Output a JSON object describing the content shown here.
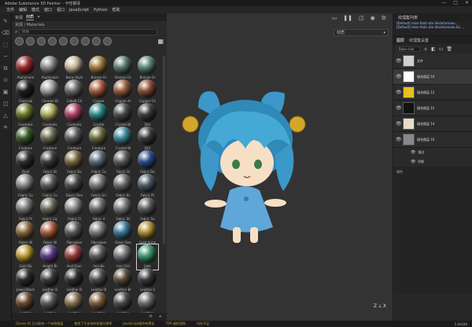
{
  "app": {
    "title": "Adobe Substance 3D Painter - 卡哇钢琴",
    "window_controls": [
      "—",
      "□",
      "✕"
    ]
  },
  "menu": [
    "文件",
    "编辑",
    "模式",
    "窗口",
    "视口",
    "JavaScript",
    "Python",
    "帮助"
  ],
  "tools": [
    "brush-icon",
    "eraser-icon",
    "projection-icon",
    "smudge-icon",
    "clone-icon",
    "picker-icon",
    "fill-icon",
    "camera-icon",
    "polygon-icon",
    "light-icon"
  ],
  "shelf": {
    "tabs": [
      "资源",
      "材质"
    ],
    "path": "资源 / Materials",
    "search_placeholder": "搜索",
    "filters": [
      "all",
      "materials",
      "smart-materials",
      "textures",
      "brushes",
      "alphas",
      "grunges",
      "procedurals",
      "environments"
    ],
    "materials": [
      {
        "label": "Aluminium",
        "color": "#9b2a2a"
      },
      {
        "label": "Aluminium",
        "color": "#8a8a8a"
      },
      {
        "label": "Bone Stylz",
        "color": "#c8b89a"
      },
      {
        "label": "Bronze Ar",
        "color": "#a07a3a"
      },
      {
        "label": "Bronze Ch",
        "color": "#5a7a6e"
      },
      {
        "label": "Bronze Gr",
        "color": "#5e8478"
      },
      {
        "label": "Charcoal",
        "color": "#1e1e1e"
      },
      {
        "label": "Chrome Bl",
        "color": "#a0a0a0"
      },
      {
        "label": "Cobalt Ch",
        "color": "#6a6a6a"
      },
      {
        "label": "Copper",
        "color": "#a95a3a"
      },
      {
        "label": "Copper Ar",
        "color": "#9a5a3a"
      },
      {
        "label": "Copper Ch",
        "color": "#8a4a32"
      },
      {
        "label": "Cosmetic",
        "color": "#6a7a2a"
      },
      {
        "label": "Cosmetic",
        "color": "#b0b060"
      },
      {
        "label": "Cosmetic",
        "color": "#b0406a"
      },
      {
        "label": "Crystal",
        "color": "#2a8a8a"
      },
      {
        "label": "Crystal Bl",
        "color": "#4a4a4a"
      },
      {
        "label": "Dirt",
        "color": "#3a3a3a"
      },
      {
        "label": "Creature",
        "color": "#3a5a2a"
      },
      {
        "label": "Creature",
        "color": "#6a6a50"
      },
      {
        "label": "Creature",
        "color": "#5a5a5a"
      },
      {
        "label": "Creature",
        "color": "#6a6a3a"
      },
      {
        "label": "Crystal Bl",
        "color": "#3a8a9a"
      },
      {
        "label": "Dirt",
        "color": "#3a3a3a"
      },
      {
        "label": "Dust",
        "color": "#2e2e2e"
      },
      {
        "label": "Fabric Bl",
        "color": "#3a3a3a"
      },
      {
        "label": "Fabric De",
        "color": "#7a6a40"
      },
      {
        "label": "Fabric Ca",
        "color": "#5a6a7a"
      },
      {
        "label": "Fabric Gl",
        "color": "#5a5a5a"
      },
      {
        "label": "Fabric De",
        "color": "#2a4a8a"
      },
      {
        "label": "Fabric Co",
        "color": "#8a8a8a"
      },
      {
        "label": "Fabric Co",
        "color": "#5a5a5a"
      },
      {
        "label": "Fabric Den",
        "color": "#4a4a4a"
      },
      {
        "label": "Fabric Gri",
        "color": "#7a7a7a"
      },
      {
        "label": "Fabric Kn",
        "color": "#6a6a6a"
      },
      {
        "label": "Fabric Pt",
        "color": "#4a5a6a"
      },
      {
        "label": "Fabric Pl",
        "color": "#7a7a7a"
      },
      {
        "label": "Fabric Lly",
        "color": "#6a6a5a"
      },
      {
        "label": "Fabric Fl",
        "color": "#8a8a8a"
      },
      {
        "label": "Fabric 4",
        "color": "#6a6a6a"
      },
      {
        "label": "Fabric Sil",
        "color": "#7a7a7a"
      },
      {
        "label": "Fabric Su",
        "color": "#5a5a5a"
      },
      {
        "label": "Fabric W",
        "color": "#8a6a3a"
      },
      {
        "label": "Fabric W",
        "color": "#aa5a3a"
      },
      {
        "label": "Fiberglass",
        "color": "#5a5a5a"
      },
      {
        "label": "Fiberglass",
        "color": "#7a7a7a"
      },
      {
        "label": "Glass Vize",
        "color": "#3a7a9a"
      },
      {
        "label": "Gold Arma",
        "color": "#b09030"
      },
      {
        "label": "Gold Da",
        "color": "#c0a030"
      },
      {
        "label": "Height Bl",
        "color": "#5a3a8a"
      },
      {
        "label": "Hull Dam",
        "color": "#9a3a3a"
      },
      {
        "label": "Iron Bo",
        "color": "#5a5a5a"
      },
      {
        "label": "Iron Chil",
        "color": "#7a7a7a"
      },
      {
        "label": "Jade",
        "color": "#3a9a6a"
      },
      {
        "label": "Jewel Black",
        "color": "#2a2a2a"
      },
      {
        "label": "Leather D",
        "color": "#3a3a3a"
      },
      {
        "label": "Leather D",
        "color": "#2e2e2e"
      },
      {
        "label": "Leather B",
        "color": "#4a4a4a"
      },
      {
        "label": "Leather Br",
        "color": "#5a4a3a"
      },
      {
        "label": "Leather S",
        "color": "#3a3a3a"
      },
      {
        "label": "Leather",
        "color": "#6a4a30"
      },
      {
        "label": "Leather",
        "color": "#5a5a5a"
      },
      {
        "label": "Leather",
        "color": "#8a7050"
      },
      {
        "label": "Leather",
        "color": "#7a5a3a"
      },
      {
        "label": "Leather",
        "color": "#4a4a4a"
      },
      {
        "label": "Leather",
        "color": "#6a6a6a"
      }
    ],
    "selected_index": 53
  },
  "viewport": {
    "mode": "材质",
    "axis": "Z ⟂ X",
    "colors": {
      "skin": "#f7dfc6",
      "hair": "#45a9d6",
      "hair_shadow": "#2f8ab8",
      "dress": "#5ea7d8",
      "bell": "#d4a62a"
    }
  },
  "layers": {
    "header": "纹理集列表",
    "stack_lines": [
      "[Default] mise thah site Veclvtumaeu ...",
      "[Default] mise thah site Veclvtumaeu Ea ..."
    ],
    "tabs": [
      "图层",
      "纹理集设置"
    ],
    "blend_mode": "Base colo",
    "items": [
      {
        "name": "文件",
        "thumb": "#cfcfcf",
        "selected": false
      },
      {
        "name": "填充图层 10",
        "thumb": "#ffffff",
        "selected": true
      },
      {
        "name": "填充图层 12",
        "thumb": "#e8c020",
        "selected": false
      },
      {
        "name": "填充图层 15",
        "thumb": "#111111",
        "selected": false
      },
      {
        "name": "填充图层 14",
        "thumb": "#e8dcc8",
        "selected": false
      },
      {
        "name": "填充图层 16",
        "thumb": "#888888",
        "selected": false
      }
    ],
    "sub_items": [
      "描边",
      "阴影"
    ],
    "props_label": "属性"
  },
  "statusbar": {
    "messages": [
      "[Scene 0] 已分配给一个材质图层",
      "使用了不支持的纹理分辨率",
      "JavaScript插件有警告",
      "TDR 被检测到",
      "内存不足"
    ],
    "right": "1.0x100"
  }
}
